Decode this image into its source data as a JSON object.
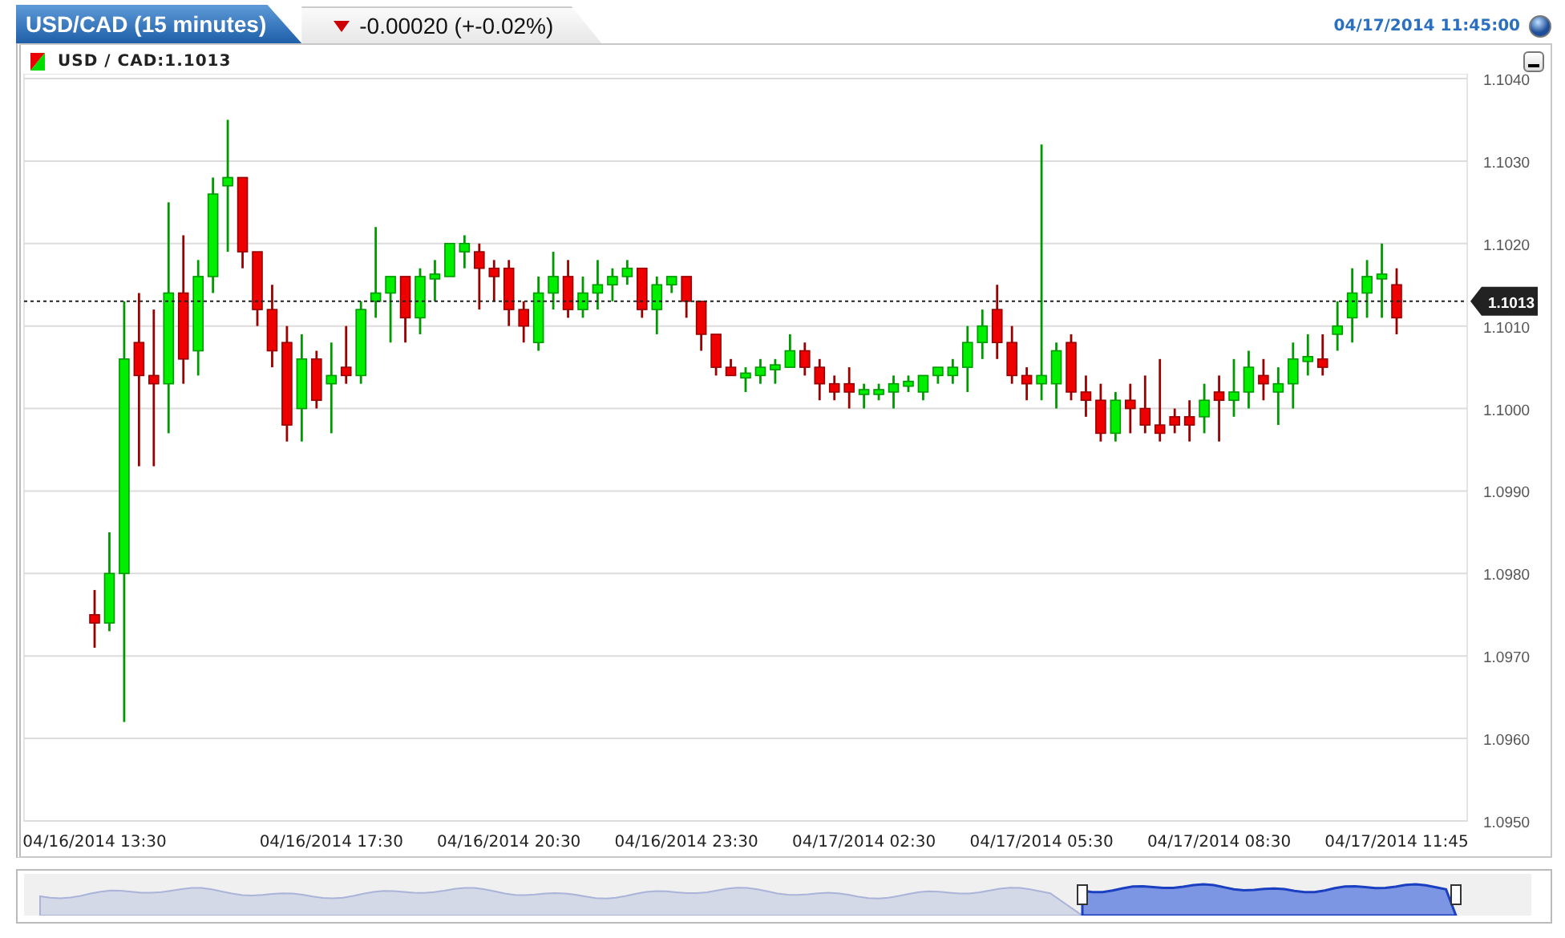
{
  "header": {
    "title": "USD/CAD (15 minutes)",
    "falling": true,
    "change": "-0.00020 (+-0.02%)",
    "timestamp": "04/17/2014 11:45:00"
  },
  "legend": {
    "label": "USD / CAD:1.1013"
  },
  "chart_data": {
    "type": "candlestick",
    "grid": true,
    "ylim": [
      1.095,
      1.104
    ],
    "yticks": [
      {
        "value": 1.104,
        "label": "1.1040"
      },
      {
        "value": 1.103,
        "label": "1.1030"
      },
      {
        "value": 1.102,
        "label": "1.1020"
      },
      {
        "value": 1.101,
        "label": "1.1010"
      },
      {
        "value": 1.1,
        "label": "1.1000"
      },
      {
        "value": 1.099,
        "label": "1.0990"
      },
      {
        "value": 1.098,
        "label": "1.0980"
      },
      {
        "value": 1.097,
        "label": "1.0970"
      },
      {
        "value": 1.096,
        "label": "1.0960"
      },
      {
        "value": 1.095,
        "label": "1.0950"
      }
    ],
    "categories": [
      "04/16/2014 13:30",
      null,
      null,
      null,
      null,
      null,
      null,
      null,
      null,
      null,
      null,
      null,
      null,
      null,
      null,
      null,
      "04/16/2014 17:30",
      null,
      null,
      null,
      null,
      null,
      null,
      null,
      null,
      null,
      null,
      null,
      "04/16/2014 20:30",
      null,
      null,
      null,
      null,
      null,
      null,
      null,
      null,
      null,
      null,
      null,
      "04/16/2014 23:30",
      null,
      null,
      null,
      null,
      null,
      null,
      null,
      null,
      null,
      null,
      null,
      "04/17/2014 02:30",
      null,
      null,
      null,
      null,
      null,
      null,
      null,
      null,
      null,
      null,
      null,
      "04/17/2014 05:30",
      null,
      null,
      null,
      null,
      null,
      null,
      null,
      null,
      null,
      null,
      null,
      "04/17/2014 08:30",
      null,
      null,
      null,
      null,
      null,
      null,
      null,
      null,
      null,
      null,
      null,
      "04/17/2014 11:45"
    ],
    "ohlc": [
      [
        1.0975,
        1.0978,
        1.0971,
        1.0974
      ],
      [
        1.0974,
        1.0985,
        1.0973,
        1.098
      ],
      [
        1.098,
        1.1013,
        1.0962,
        1.1006
      ],
      [
        1.1008,
        1.1014,
        1.0993,
        1.1004
      ],
      [
        1.1004,
        1.1012,
        1.0993,
        1.1003
      ],
      [
        1.1003,
        1.1025,
        1.0997,
        1.1014
      ],
      [
        1.1014,
        1.1021,
        1.1003,
        1.1006
      ],
      [
        1.1007,
        1.1018,
        1.1004,
        1.1016
      ],
      [
        1.1016,
        1.1028,
        1.1014,
        1.1026
      ],
      [
        1.1027,
        1.1035,
        1.1019,
        1.1028
      ],
      [
        1.1028,
        1.1028,
        1.1017,
        1.1019
      ],
      [
        1.1019,
        1.1019,
        1.101,
        1.1012
      ],
      [
        1.1012,
        1.1015,
        1.1005,
        1.1007
      ],
      [
        1.1008,
        1.101,
        1.0996,
        1.0998
      ],
      [
        1.1,
        1.1009,
        1.0996,
        1.1006
      ],
      [
        1.1006,
        1.1007,
        1.1,
        1.1001
      ],
      [
        1.1003,
        1.1008,
        1.0997,
        1.1004
      ],
      [
        1.1005,
        1.101,
        1.1003,
        1.1004
      ],
      [
        1.1004,
        1.1013,
        1.1003,
        1.1012
      ],
      [
        1.1013,
        1.1022,
        1.1011,
        1.1014
      ],
      [
        1.1014,
        1.1016,
        1.1008,
        1.1016
      ],
      [
        1.1016,
        1.1016,
        1.1008,
        1.1011
      ],
      [
        1.1011,
        1.1017,
        1.1009,
        1.1016
      ],
      [
        1.1016,
        1.1018,
        1.1013,
        1.1016
      ],
      [
        1.1016,
        1.102,
        1.1016,
        1.102
      ],
      [
        1.1019,
        1.1021,
        1.1017,
        1.102
      ],
      [
        1.1019,
        1.102,
        1.1012,
        1.1017
      ],
      [
        1.1017,
        1.1018,
        1.1013,
        1.1016
      ],
      [
        1.1017,
        1.1018,
        1.101,
        1.1012
      ],
      [
        1.1012,
        1.1013,
        1.1008,
        1.101
      ],
      [
        1.1008,
        1.1016,
        1.1007,
        1.1014
      ],
      [
        1.1014,
        1.1019,
        1.1012,
        1.1016
      ],
      [
        1.1016,
        1.1018,
        1.1011,
        1.1012
      ],
      [
        1.1012,
        1.1016,
        1.1011,
        1.1014
      ],
      [
        1.1014,
        1.1018,
        1.1012,
        1.1015
      ],
      [
        1.1015,
        1.1017,
        1.1013,
        1.1016
      ],
      [
        1.1016,
        1.1018,
        1.1015,
        1.1017
      ],
      [
        1.1017,
        1.1017,
        1.1011,
        1.1012
      ],
      [
        1.1012,
        1.1016,
        1.1009,
        1.1015
      ],
      [
        1.1015,
        1.1016,
        1.1014,
        1.1016
      ],
      [
        1.1016,
        1.1016,
        1.1011,
        1.1013
      ],
      [
        1.1013,
        1.1013,
        1.1007,
        1.1009
      ],
      [
        1.1009,
        1.1009,
        1.1004,
        1.1005
      ],
      [
        1.1005,
        1.1006,
        1.1004,
        1.1004
      ],
      [
        1.1004,
        1.1005,
        1.1002,
        1.1004
      ],
      [
        1.1004,
        1.1006,
        1.1003,
        1.1005
      ],
      [
        1.1005,
        1.1006,
        1.1003,
        1.1005
      ],
      [
        1.1005,
        1.1009,
        1.1005,
        1.1007
      ],
      [
        1.1007,
        1.1008,
        1.1004,
        1.1005
      ],
      [
        1.1005,
        1.1006,
        1.1001,
        1.1003
      ],
      [
        1.1003,
        1.1004,
        1.1001,
        1.1002
      ],
      [
        1.1003,
        1.1005,
        1.1,
        1.1002
      ],
      [
        1.1002,
        1.1003,
        1.1,
        1.1002
      ],
      [
        1.1002,
        1.1003,
        1.1001,
        1.1002
      ],
      [
        1.1002,
        1.1004,
        1.1,
        1.1003
      ],
      [
        1.1003,
        1.1004,
        1.1002,
        1.1003
      ],
      [
        1.1002,
        1.1004,
        1.1001,
        1.1004
      ],
      [
        1.1004,
        1.1005,
        1.1003,
        1.1005
      ],
      [
        1.1004,
        1.1006,
        1.1003,
        1.1005
      ],
      [
        1.1005,
        1.101,
        1.1002,
        1.1008
      ],
      [
        1.1008,
        1.1012,
        1.1006,
        1.101
      ],
      [
        1.1012,
        1.1015,
        1.1006,
        1.1008
      ],
      [
        1.1008,
        1.101,
        1.1003,
        1.1004
      ],
      [
        1.1004,
        1.1005,
        1.1001,
        1.1003
      ],
      [
        1.1003,
        1.1032,
        1.1001,
        1.1004
      ],
      [
        1.1003,
        1.1008,
        1.1,
        1.1007
      ],
      [
        1.1008,
        1.1009,
        1.1001,
        1.1002
      ],
      [
        1.1002,
        1.1004,
        1.0999,
        1.1001
      ],
      [
        1.1001,
        1.1003,
        1.0996,
        1.0997
      ],
      [
        1.0997,
        1.1002,
        1.0996,
        1.1001
      ],
      [
        1.1001,
        1.1003,
        1.0997,
        1.1
      ],
      [
        1.1,
        1.1004,
        1.0997,
        1.0998
      ],
      [
        1.0998,
        1.1006,
        1.0996,
        1.0997
      ],
      [
        1.0999,
        1.1,
        1.0997,
        1.0998
      ],
      [
        1.0999,
        1.1001,
        1.0996,
        1.0998
      ],
      [
        1.0999,
        1.1003,
        1.0997,
        1.1001
      ],
      [
        1.1002,
        1.1004,
        1.0996,
        1.1001
      ],
      [
        1.1001,
        1.1006,
        1.0999,
        1.1002
      ],
      [
        1.1002,
        1.1007,
        1.1,
        1.1005
      ],
      [
        1.1004,
        1.1006,
        1.1001,
        1.1003
      ],
      [
        1.1002,
        1.1005,
        1.0998,
        1.1003
      ],
      [
        1.1003,
        1.1008,
        1.1,
        1.1006
      ],
      [
        1.1006,
        1.1009,
        1.1004,
        1.1006
      ],
      [
        1.1006,
        1.1009,
        1.1004,
        1.1005
      ],
      [
        1.1009,
        1.1013,
        1.1007,
        1.101
      ],
      [
        1.1011,
        1.1017,
        1.1008,
        1.1014
      ],
      [
        1.1014,
        1.1018,
        1.1011,
        1.1016
      ],
      [
        1.1016,
        1.102,
        1.1011,
        1.1016
      ],
      [
        1.1015,
        1.1017,
        1.1009,
        1.1011
      ]
    ],
    "ref_lines": [
      {
        "axis": "y",
        "value": 1.1013,
        "label": "1.1013"
      }
    ]
  }
}
